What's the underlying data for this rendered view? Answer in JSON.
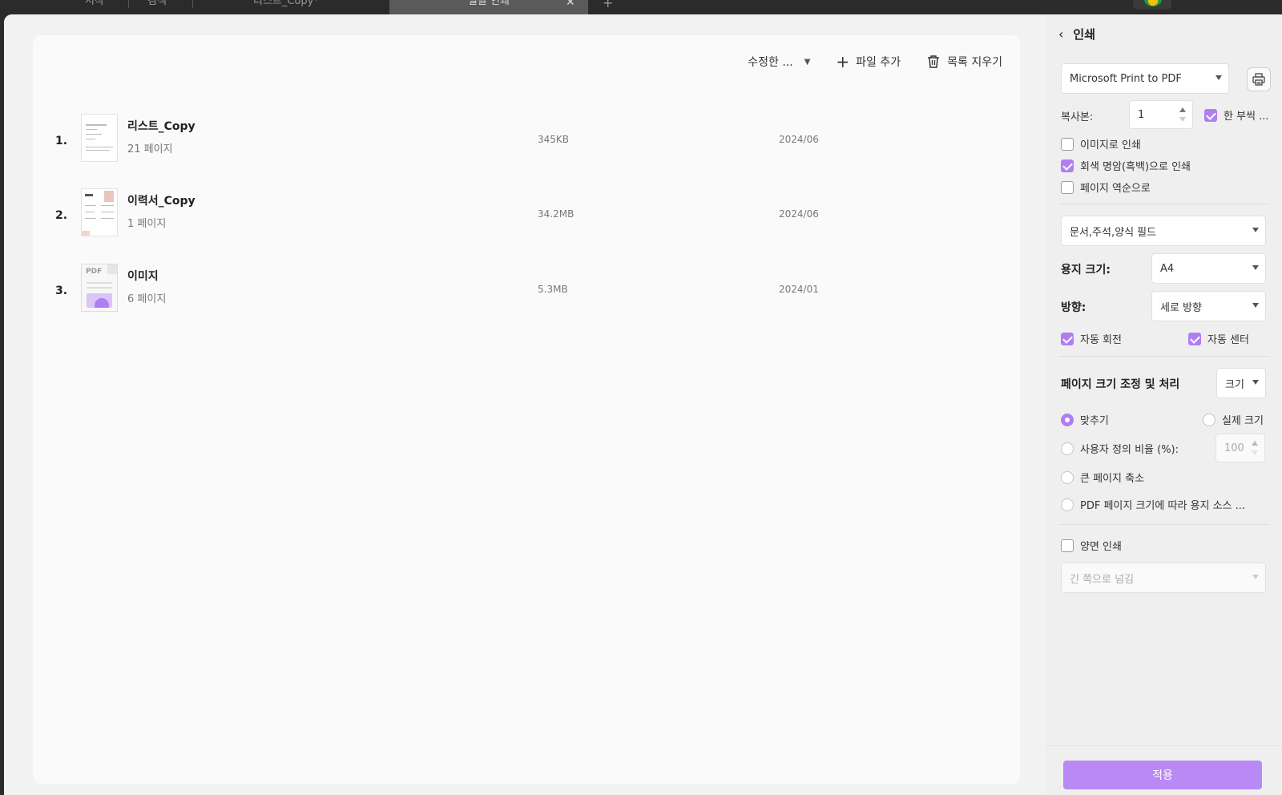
{
  "tabs": [
    {
      "label": "시작"
    },
    {
      "label": "검색"
    },
    {
      "label": "리스트_Copy*"
    },
    {
      "label": "일괄 인쇄"
    }
  ],
  "toolbar": {
    "sort_label": "수정한 ...",
    "add_file_label": "파일 추가",
    "clear_list_label": "목록 지우기"
  },
  "files": [
    {
      "num": "1.",
      "name": "리스트_Copy",
      "pages": "21 페이지",
      "size": "345KB",
      "date": "2024/06"
    },
    {
      "num": "2.",
      "name": "이력서_Copy",
      "pages": "1 페이지",
      "size": "34.2MB",
      "date": "2024/06"
    },
    {
      "num": "3.",
      "name": "이미지",
      "pages": "6 페이지",
      "size": "5.3MB",
      "date": "2024/01"
    }
  ],
  "thumb_pdf_label": "PDF",
  "panel": {
    "title": "인쇄",
    "printer": "Microsoft Print to PDF",
    "copies_label": "복사본:",
    "copies_value": "1",
    "collate_label": "한 부씩 ...",
    "print_as_image_label": "이미지로 인쇄",
    "grayscale_label": "회색 명암(흑백)으로 인쇄",
    "reverse_label": "페이지 역순으로",
    "content_select": "문서,주석,양식 필드",
    "paper_size_label": "용지 크기:",
    "paper_size_value": "A4",
    "orientation_label": "방향:",
    "orientation_value": "세로 방향",
    "auto_rotate_label": "자동 회전",
    "auto_center_label": "자동 센터",
    "scaling_title": "페이지 크기 조정 및 처리",
    "scaling_mode": "크기",
    "fit_label": "맞추기",
    "actual_size_label": "실제 크기",
    "custom_scale_label": "사용자 정의 비율 (%):",
    "custom_scale_value": "100",
    "shrink_label": "큰 페이지 축소",
    "paper_source_label": "PDF 페이지 크기에 따라 용지 소스 ...",
    "duplex_label": "양면 인쇄",
    "flip_select": "긴 쪽으로 넘김",
    "apply_label": "적용"
  },
  "colors": {
    "accent": "#b07ef2",
    "apply_button": "#b98af5"
  }
}
